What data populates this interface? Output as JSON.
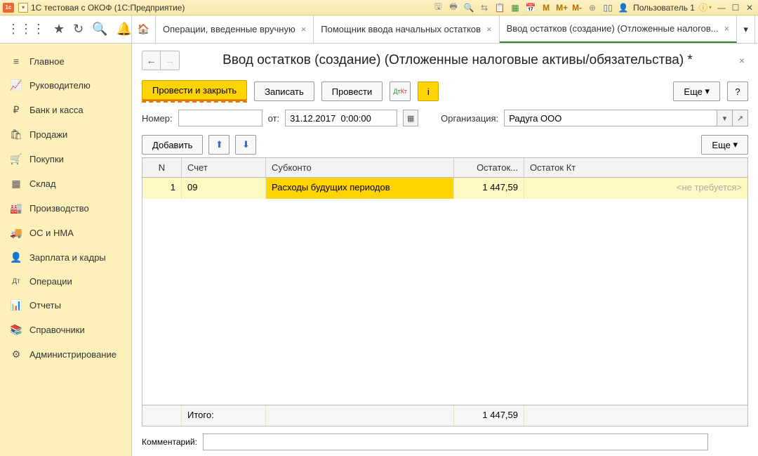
{
  "titlebar": {
    "title": "1С тестовая с ОКОФ  (1С:Предприятие)",
    "user": "Пользователь 1",
    "m_icons": [
      "M",
      "M+",
      "M-"
    ]
  },
  "tabs": {
    "t1": "Операции, введенные вручную",
    "t2": "Помощник ввода начальных остатков",
    "t3": "Ввод остатков (создание) (Отложенные налогов..."
  },
  "sidebar": {
    "items": [
      {
        "icon": "≡",
        "label": "Главное"
      },
      {
        "icon": "📈",
        "label": "Руководителю"
      },
      {
        "icon": "₽",
        "label": "Банк и касса"
      },
      {
        "icon": "🛍",
        "label": "Продажи"
      },
      {
        "icon": "🛒",
        "label": "Покупки"
      },
      {
        "icon": "▦",
        "label": "Склад"
      },
      {
        "icon": "🏭",
        "label": "Производство"
      },
      {
        "icon": "🚚",
        "label": "ОС и НМА"
      },
      {
        "icon": "👤",
        "label": "Зарплата и кадры"
      },
      {
        "icon": "Дт",
        "label": "Операции"
      },
      {
        "icon": "📊",
        "label": "Отчеты"
      },
      {
        "icon": "📚",
        "label": "Справочники"
      },
      {
        "icon": "⚙",
        "label": "Администрирование"
      }
    ]
  },
  "page": {
    "title": "Ввод остатков (создание) (Отложенные налоговые активы/обязательства) *"
  },
  "actions": {
    "post_close": "Провести и закрыть",
    "save": "Записать",
    "post": "Провести",
    "more": "Еще",
    "help": "?"
  },
  "fields": {
    "number_label": "Номер:",
    "number": "",
    "from_label": "от:",
    "date": "31.12.2017  0:00:00",
    "org_label": "Организация:",
    "org": "Радуга ООО"
  },
  "tcontrols": {
    "add": "Добавить",
    "more": "Еще"
  },
  "table": {
    "headers": {
      "n": "N",
      "acct": "Счет",
      "sub": "Субконто",
      "dt": "Остаток...",
      "kt": "Остаток Кт"
    },
    "rows": [
      {
        "n": "1",
        "acct": "09",
        "sub": "Расходы будущих периодов",
        "dt": "1 447,59",
        "kt": "<не требуется>"
      }
    ],
    "footer": {
      "label": "Итого:",
      "dt": "1 447,59"
    }
  },
  "comment": {
    "label": "Комментарий:",
    "value": ""
  }
}
